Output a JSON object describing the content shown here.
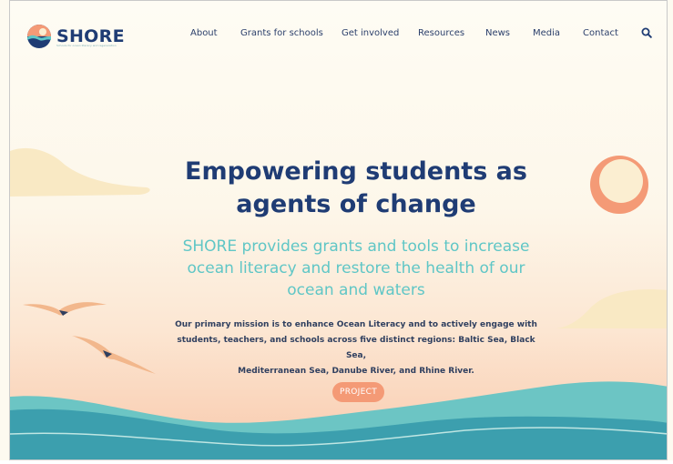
{
  "brand": {
    "name": "SHORE",
    "tagline": "Schools for ocean literacy and regeneration",
    "colors": {
      "navy": "#1f3c74",
      "teal": "#5fc6c6",
      "coral": "#f49a76",
      "cream": "#fdfaf0"
    }
  },
  "nav": {
    "items": [
      "About",
      "Grants for schools",
      "Get involved",
      "Resources",
      "News",
      "Media",
      "Contact"
    ],
    "search_icon": "search-icon"
  },
  "hero": {
    "title_line1": "Empowering students as",
    "title_line2": "agents of change",
    "subtitle_line1": "SHORE provides grants and tools to increase",
    "subtitle_line2": "ocean literacy and restore the health of our",
    "subtitle_line3": "ocean and waters",
    "body_line1": "Our primary mission is to enhance Ocean Literacy and to actively engage with",
    "body_line2": "students, teachers, and schools across five distinct regions: Baltic Sea, Black Sea,",
    "body_line3": "Mediterranean Sea, Danube River, and Rhine River.",
    "cta_label": "PROJECT"
  },
  "illustration": {
    "icons": [
      "sun-icon",
      "cloud-icon",
      "seagull-icon",
      "wave-icon"
    ]
  }
}
